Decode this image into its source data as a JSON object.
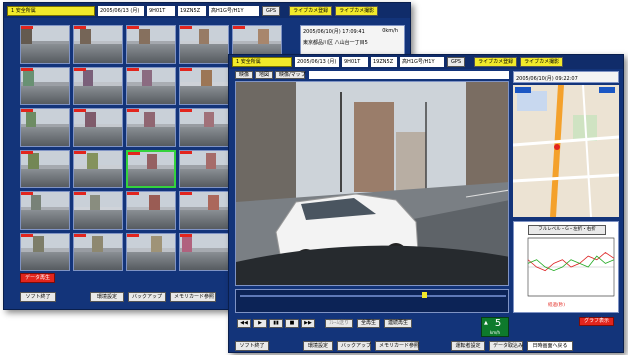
{
  "back_window": {
    "toolbar": {
      "camera_select": "1 安全所属",
      "date_from": "2005/06/13 (月)",
      "time_from": "9H01T",
      "time_to": "19ZN5Z",
      "status": "高H1G号/H1Y",
      "gps_label": "GPS",
      "live_monitor_label": "ライブカメ登録",
      "live_edit_label": "ライブカメ撮影"
    },
    "info": {
      "datetime": "2005/06/10(月) 17:09:41",
      "speed": "0km/h",
      "address": "東京都品川区 八山台一丁目5"
    },
    "playback_label": "データ再生",
    "buttons": {
      "exit": "ソフト終了",
      "settings": "環境設定",
      "backup": "バックアップ",
      "card": "メモリカード参照"
    }
  },
  "front_window": {
    "toolbar": {
      "camera_select": "1 安全所属",
      "date_from": "2005/06/13 (月)",
      "time_from": "9H01T",
      "time_to": "19ZN5Z",
      "status": "高H1G号/H1Y",
      "gps_label": "GPS",
      "live_monitor_label": "ライブカメ登録",
      "live_edit_label": "ライブカメ撮影"
    },
    "tabs": [
      "映像",
      "地図",
      "映像/マップ"
    ],
    "map_datetime": "2005/06/10(月) 09:22:07",
    "graph": {
      "title": "フルレベル・G・左折・右折",
      "ylabel": "加速度",
      "xlabel": "経過(秒)"
    },
    "graph_button": "グラフ表示",
    "controls": {
      "play_labels": [
        "◀◀",
        "▶",
        "▮▮",
        "■",
        "▶▶"
      ],
      "disabled_btn": "ﾌﾚｰﾑ送り",
      "all_play": "全再生",
      "continuous": "連続再生"
    },
    "counter": {
      "icon_text": "▲",
      "value": "5",
      "unit": "km/h"
    },
    "buttons": {
      "exit": "ソフト終了",
      "settings": "環境設定",
      "backup": "バックアップ",
      "card": "メモリカード参照",
      "save": "運転者設定",
      "data_import": "データ取込み",
      "return": "日時画面へ戻る"
    },
    "chart_data": {
      "type": "line",
      "series": [
        {
          "color": "#d22",
          "values": [
            0.1,
            0.0,
            -0.05,
            0.05,
            0.1,
            0.0,
            0.05,
            0.15,
            0.1,
            0.2,
            0.12
          ]
        },
        {
          "color": "#2a2",
          "values": [
            0.05,
            0.1,
            0.0,
            -0.05,
            0.0,
            0.1,
            0.05,
            0.0,
            0.15,
            0.05,
            0.1
          ]
        }
      ],
      "ylim": [
        -0.4,
        0.4
      ]
    }
  }
}
